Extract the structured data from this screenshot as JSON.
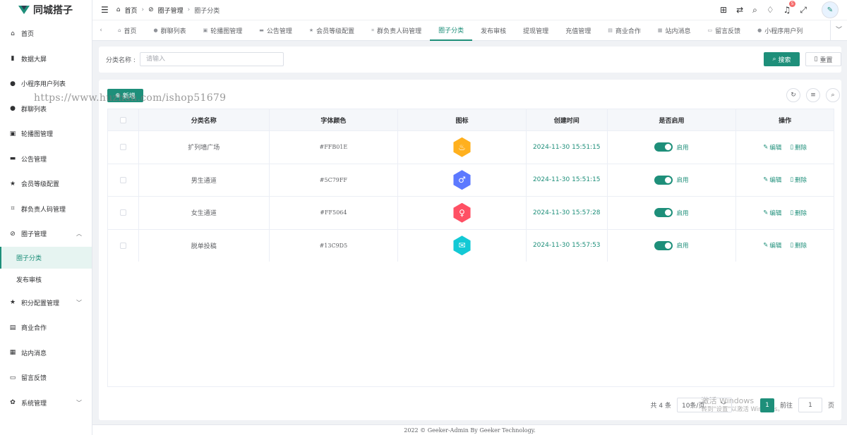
{
  "app": {
    "name": "同城搭子"
  },
  "sidebar": {
    "items": [
      {
        "label": "首页",
        "icon": "home-icon",
        "glyph": "⌂"
      },
      {
        "label": "数据大屏",
        "icon": "bar-chart-icon",
        "glyph": "▮"
      },
      {
        "label": "小程序用户列表",
        "icon": "user-icon",
        "glyph": "●"
      },
      {
        "label": "群聊列表",
        "icon": "user-icon",
        "glyph": "●"
      },
      {
        "label": "轮播图管理",
        "icon": "image-icon",
        "glyph": "▣"
      },
      {
        "label": "公告管理",
        "icon": "message-icon",
        "glyph": "▬"
      },
      {
        "label": "会员等级配置",
        "icon": "star-icon",
        "glyph": "★"
      },
      {
        "label": "群负责人码管理",
        "icon": "scan-icon",
        "glyph": "⌗"
      },
      {
        "label": "圈子管理",
        "icon": "link-icon",
        "glyph": "⊘"
      },
      {
        "label": "圈子分类"
      },
      {
        "label": "发布审核"
      },
      {
        "label": "积分配置管理",
        "icon": "star-icon",
        "glyph": "★"
      },
      {
        "label": "商业合作",
        "icon": "briefcase-icon",
        "glyph": "▤"
      },
      {
        "label": "站内消息",
        "icon": "suitcase-icon",
        "glyph": "▦"
      },
      {
        "label": "留言反馈",
        "icon": "chat-icon",
        "glyph": "▭"
      },
      {
        "label": "系统管理",
        "icon": "gear-icon",
        "glyph": "✿"
      }
    ]
  },
  "header": {
    "breadcrumb": [
      "首页",
      "圈子管理",
      "圈子分类"
    ],
    "notification_count": "5"
  },
  "tabs": [
    {
      "label": "首页",
      "glyph": "⌂"
    },
    {
      "label": "群聊列表",
      "glyph": "●"
    },
    {
      "label": "轮播图管理",
      "glyph": "▣"
    },
    {
      "label": "公告管理",
      "glyph": "▬"
    },
    {
      "label": "会员等级配置",
      "glyph": "★"
    },
    {
      "label": "群负责人码管理",
      "glyph": "⌗"
    },
    {
      "label": "圈子分类",
      "glyph": ""
    },
    {
      "label": "发布审核",
      "glyph": ""
    },
    {
      "label": "提现管理",
      "glyph": ""
    },
    {
      "label": "充值管理",
      "glyph": ""
    },
    {
      "label": "商业合作",
      "glyph": "▤"
    },
    {
      "label": "站内消息",
      "glyph": "▦"
    },
    {
      "label": "留言反馈",
      "glyph": "▭"
    },
    {
      "label": "小程序用户列",
      "glyph": "●"
    }
  ],
  "active_tab": "圈子分类",
  "search": {
    "label": "分类名称 :",
    "placeholder": "请输入",
    "search_button": "搜索",
    "reset_button": "重置"
  },
  "toolbar": {
    "add_button": "新增"
  },
  "watermark": "https://www.huzhan.com/ishop51679",
  "table": {
    "columns": [
      "分类名称",
      "字体颜色",
      "图标",
      "创建时间",
      "是否启用",
      "操作"
    ],
    "rows": [
      {
        "name": "扩列墙广场",
        "color": "#FFB01E",
        "created": "2024-11-30 15:51:15",
        "enabled": "启用",
        "icon_glyph": "♨"
      },
      {
        "name": "男生通道",
        "color": "#5C79FF",
        "created": "2024-11-30 15:51:15",
        "enabled": "启用",
        "icon_glyph": "♂"
      },
      {
        "name": "女生通道",
        "color": "#FF5064",
        "created": "2024-11-30 15:57:28",
        "enabled": "启用",
        "icon_glyph": "♀"
      },
      {
        "name": "脱单投稿",
        "color": "#13C9D5",
        "created": "2024-11-30 15:57:53",
        "enabled": "启用",
        "icon_glyph": "✉"
      }
    ],
    "edit_label": "编辑",
    "delete_label": "删除"
  },
  "pagination": {
    "total": "共 4 条",
    "page_size": "10条/页",
    "current_page": "1",
    "goto_label": "前往",
    "goto_value": "1",
    "page_suffix": "页"
  },
  "windows_watermark": {
    "line1": "激活 Windows",
    "line2": "转到\"设置\"以激活 Windows。"
  },
  "footer": "2022 © Geeker-Admin By Geeker Technology."
}
